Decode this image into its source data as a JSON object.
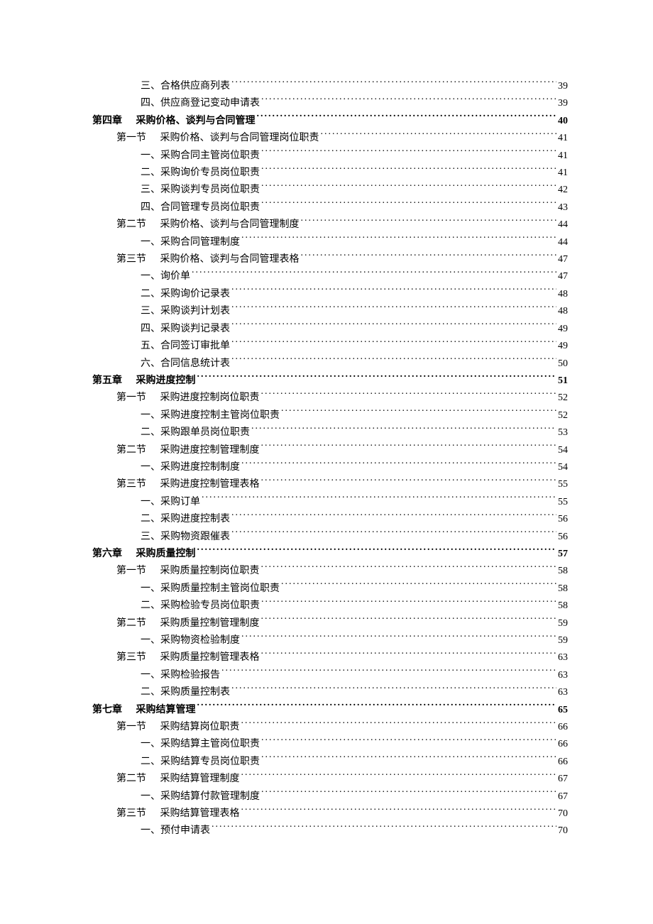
{
  "toc": [
    {
      "level": "item",
      "num": "三、",
      "title": "合格供应商列表",
      "page": "39"
    },
    {
      "level": "item",
      "num": "四、",
      "title": "供应商登记变动申请表",
      "page": "39"
    },
    {
      "level": "chapter",
      "num": "第四章",
      "title": "采购价格、谈判与合同管理",
      "page": "40"
    },
    {
      "level": "section",
      "num": "第一节",
      "title": "采购价格、谈判与合同管理岗位职责",
      "page": "41"
    },
    {
      "level": "item",
      "num": "一、",
      "title": "采购合同主管岗位职责",
      "page": "41"
    },
    {
      "level": "item",
      "num": "二、",
      "title": "采购询价专员岗位职责",
      "page": "41"
    },
    {
      "level": "item",
      "num": "三、",
      "title": "采购谈判专员岗位职责",
      "page": "42"
    },
    {
      "level": "item",
      "num": "四、",
      "title": "合同管理专员岗位职责",
      "page": "43"
    },
    {
      "level": "section",
      "num": "第二节",
      "title": "采购价格、谈判与合同管理制度",
      "page": "44"
    },
    {
      "level": "item",
      "num": "一、",
      "title": "采购合同管理制度",
      "page": "44"
    },
    {
      "level": "section",
      "num": "第三节",
      "title": "采购价格、谈判与合同管理表格",
      "page": "47"
    },
    {
      "level": "item",
      "num": "一、",
      "title": "询价单",
      "page": "47"
    },
    {
      "level": "item",
      "num": "二、",
      "title": "采购询价记录表",
      "page": "48"
    },
    {
      "level": "item",
      "num": "三、",
      "title": "采购谈判计划表",
      "page": "48"
    },
    {
      "level": "item",
      "num": "四、",
      "title": "采购谈判记录表",
      "page": "49"
    },
    {
      "level": "item",
      "num": "五、",
      "title": "合同签订审批单",
      "page": "49"
    },
    {
      "level": "item",
      "num": "六、",
      "title": "合同信息统计表",
      "page": "50"
    },
    {
      "level": "chapter",
      "num": "第五章",
      "title": "采购进度控制",
      "page": "51"
    },
    {
      "level": "section",
      "num": "第一节",
      "title": "采购进度控制岗位职责",
      "page": "52"
    },
    {
      "level": "item",
      "num": "一、",
      "title": "采购进度控制主管岗位职责",
      "page": "52"
    },
    {
      "level": "item",
      "num": "二、",
      "title": "采购跟单员岗位职责",
      "page": "53"
    },
    {
      "level": "section",
      "num": "第二节",
      "title": "采购进度控制管理制度",
      "page": "54"
    },
    {
      "level": "item",
      "num": "一、",
      "title": "采购进度控制制度",
      "page": "54"
    },
    {
      "level": "section",
      "num": "第三节",
      "title": "采购进度控制管理表格",
      "page": "55"
    },
    {
      "level": "item",
      "num": "一、",
      "title": "采购订单",
      "page": "55"
    },
    {
      "level": "item",
      "num": "二、",
      "title": "采购进度控制表",
      "page": "56"
    },
    {
      "level": "item",
      "num": "三、",
      "title": "采购物资跟催表",
      "page": "56"
    },
    {
      "level": "chapter",
      "num": "第六章",
      "title": "采购质量控制",
      "page": "57"
    },
    {
      "level": "section",
      "num": "第一节",
      "title": "采购质量控制岗位职责",
      "page": "58"
    },
    {
      "level": "item",
      "num": "一、",
      "title": "采购质量控制主管岗位职责",
      "page": "58"
    },
    {
      "level": "item",
      "num": "二、",
      "title": "采购检验专员岗位职责",
      "page": "58"
    },
    {
      "level": "section",
      "num": "第二节",
      "title": "采购质量控制管理制度",
      "page": "59"
    },
    {
      "level": "item",
      "num": "一、",
      "title": "采购物资检验制度",
      "page": "59"
    },
    {
      "level": "section",
      "num": "第三节",
      "title": "采购质量控制管理表格",
      "page": "63"
    },
    {
      "level": "item",
      "num": "一、",
      "title": "采购检验报告",
      "page": "63"
    },
    {
      "level": "item",
      "num": "二、",
      "title": "采购质量控制表",
      "page": "63"
    },
    {
      "level": "chapter",
      "num": "第七章",
      "title": "采购结算管理",
      "page": "65"
    },
    {
      "level": "section",
      "num": "第一节",
      "title": "采购结算岗位职责",
      "page": "66"
    },
    {
      "level": "item",
      "num": "一、",
      "title": "采购结算主管岗位职责",
      "page": "66"
    },
    {
      "level": "item",
      "num": "二、",
      "title": "采购结算专员岗位职责",
      "page": "66"
    },
    {
      "level": "section",
      "num": "第二节",
      "title": "采购结算管理制度",
      "page": "67"
    },
    {
      "level": "item",
      "num": "一、",
      "title": "采购结算付款管理制度",
      "page": "67"
    },
    {
      "level": "section",
      "num": "第三节",
      "title": "采购结算管理表格",
      "page": "70"
    },
    {
      "level": "item",
      "num": "一、",
      "title": "预付申请表",
      "page": "70"
    }
  ]
}
